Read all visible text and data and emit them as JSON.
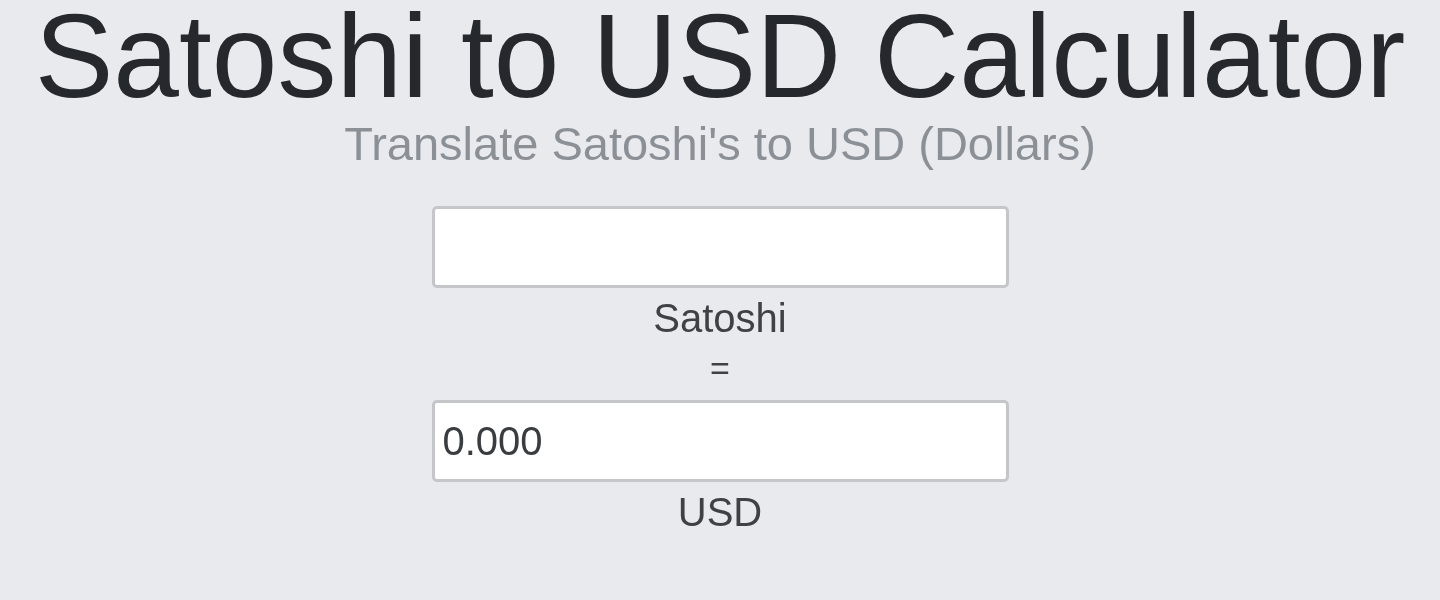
{
  "title": "Satoshi to USD Calculator",
  "subtitle": "Translate Satoshi's to USD (Dollars)",
  "converter": {
    "input": {
      "label": "Satoshi"
    },
    "equals": "=",
    "output": {
      "value": "0.000",
      "label": "USD"
    }
  }
}
